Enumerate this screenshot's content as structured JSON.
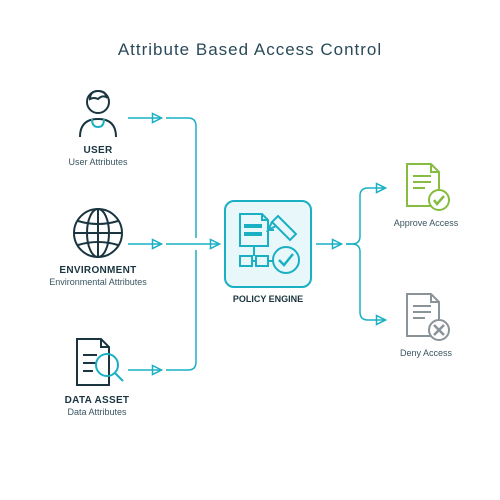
{
  "title": "Attribute Based Access Control",
  "nodes": {
    "user": {
      "title": "USER",
      "sub": "User Attributes"
    },
    "environment": {
      "title": "ENVIRONMENT",
      "sub": "Environmental Attributes"
    },
    "data_asset": {
      "title": "DATA ASSET",
      "sub": "Data Attributes"
    },
    "policy": {
      "label": "POLICY ENGINE"
    },
    "approve": {
      "label": "Approve Access"
    },
    "deny": {
      "label": "Deny Access"
    }
  },
  "colors": {
    "dark": "#1a3540",
    "teal": "#1ab0c4",
    "green": "#86bc40",
    "gray": "#8a9398",
    "text": "#3a5560"
  }
}
